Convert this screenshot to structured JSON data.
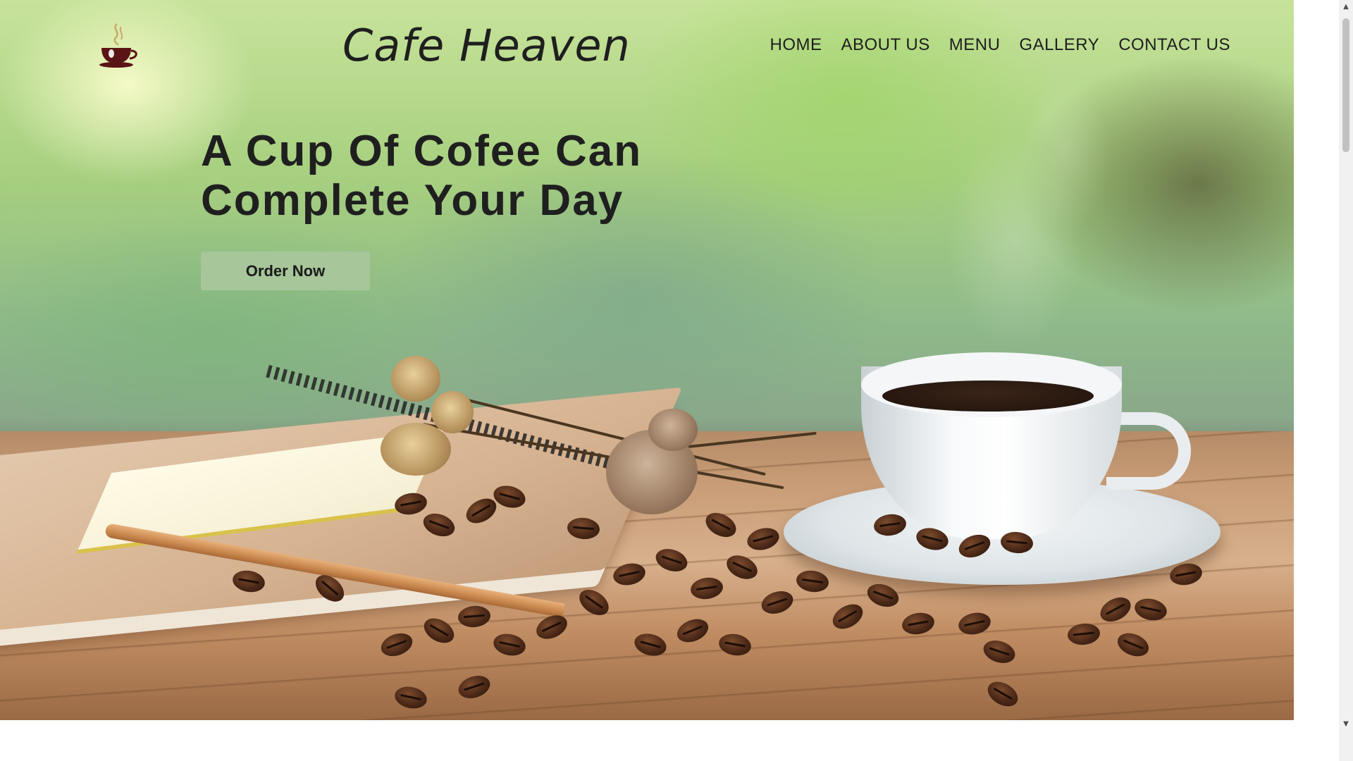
{
  "header": {
    "brand": "Cafe Heaven",
    "logo_icon": "coffee-cup-icon",
    "nav": [
      {
        "label": "HOME"
      },
      {
        "label": "ABOUT US"
      },
      {
        "label": "MENU"
      },
      {
        "label": "GALLERY"
      },
      {
        "label": "CONTACT US"
      }
    ]
  },
  "hero": {
    "headline_line1": "A Cup Of Cofee Can",
    "headline_line2": "Complete Your Day",
    "cta_label": "Order Now",
    "image": "coffee-cup-beans-notebook-photo"
  },
  "colors": {
    "cta_background": "#a7c69a",
    "text": "#1f1f1f",
    "logo_cup": "#5a1414"
  }
}
